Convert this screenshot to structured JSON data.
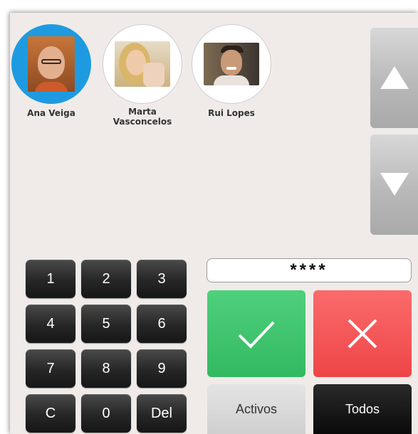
{
  "users": [
    {
      "name": "Ana Veiga",
      "selected": true
    },
    {
      "name": "Marta Vasconcelos",
      "selected": false
    },
    {
      "name": "Rui Lopes",
      "selected": false
    }
  ],
  "scroll": {
    "up_icon": "triangle-up-icon",
    "down_icon": "triangle-down-icon"
  },
  "pin": {
    "value": "****"
  },
  "keypad": {
    "k1": "1",
    "k2": "2",
    "k3": "3",
    "k4": "4",
    "k5": "5",
    "k6": "6",
    "k7": "7",
    "k8": "8",
    "k9": "9",
    "clear": "C",
    "k0": "0",
    "del": "Del"
  },
  "actions": {
    "confirm_icon": "checkmark-icon",
    "cancel_icon": "x-icon"
  },
  "filters": {
    "active": "Activos",
    "all": "Todos"
  },
  "colors": {
    "selected_ring": "#1e9be0",
    "confirm": "#3cc46b",
    "cancel": "#f25454"
  }
}
